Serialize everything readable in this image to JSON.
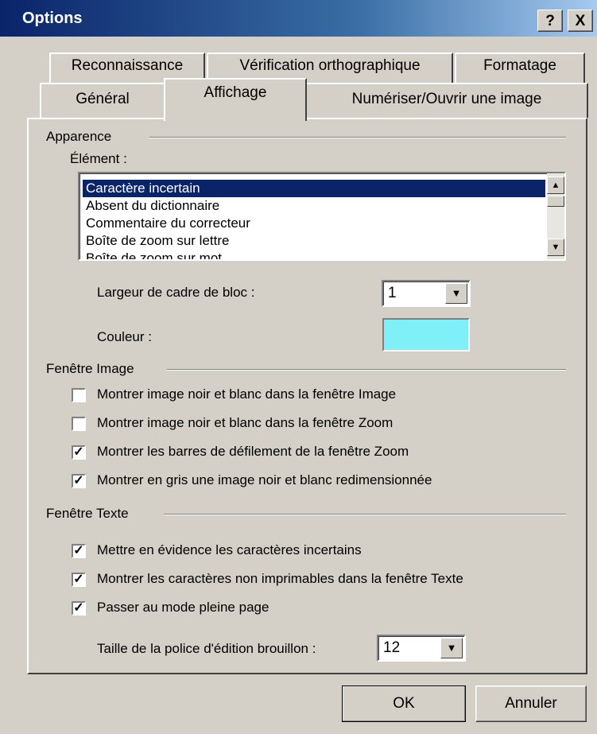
{
  "window": {
    "title": "Options",
    "help_button": "?",
    "close_button": "X"
  },
  "tabs": {
    "row1": [
      "Reconnaissance",
      "Vérification orthographique",
      "Formatage"
    ],
    "row2": [
      "Général",
      "Affichage",
      "Numériser/Ouvrir une image"
    ],
    "active": "Affichage"
  },
  "appearance": {
    "group_label": "Apparence",
    "element_label": "Élément :",
    "elements": [
      "Caractère incertain",
      "Absent du dictionnaire",
      "Commentaire du correcteur",
      "Boîte de zoom sur lettre",
      "Boîte de zoom sur mot"
    ],
    "selected_element": "Caractère incertain",
    "frame_width_label": "Largeur de cadre de bloc :",
    "frame_width_value": "1",
    "color_label": "Couleur :",
    "color_value": "#80f0f8"
  },
  "image_window": {
    "group_label": "Fenêtre Image",
    "options": [
      {
        "label": "Montrer image noir et blanc dans la fenêtre Image",
        "checked": false
      },
      {
        "label": "Montrer image noir et blanc dans la fenêtre Zoom",
        "checked": false
      },
      {
        "label": "Montrer les barres de défilement de la fenêtre Zoom",
        "checked": true
      },
      {
        "label": "Montrer en gris une image noir et blanc redimensionnée",
        "checked": true
      }
    ]
  },
  "text_window": {
    "group_label": "Fenêtre Texte",
    "options": [
      {
        "label": "Mettre en évidence les caractères incertains",
        "checked": true
      },
      {
        "label": "Montrer les caractères non imprimables dans la fenêtre Texte",
        "checked": true
      },
      {
        "label": "Passer au mode pleine page",
        "checked": true
      }
    ],
    "font_size_label": "Taille de la police d'édition brouillon :",
    "font_size_value": "12"
  },
  "buttons": {
    "ok": "OK",
    "cancel": "Annuler"
  }
}
